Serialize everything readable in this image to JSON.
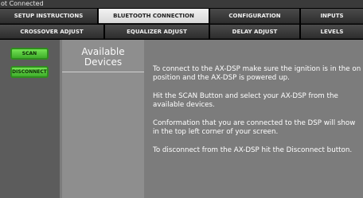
{
  "status": {
    "connection_text": "ot Connected"
  },
  "tabs": {
    "row1": [
      {
        "label": "SETUP INSTRUCTIONS",
        "active": false
      },
      {
        "label": "BLUETOOTH CONNECTION",
        "active": true
      },
      {
        "label": "CONFIGURATION",
        "active": false
      },
      {
        "label": "INPUTS",
        "active": false
      }
    ],
    "row2": [
      {
        "label": "CROSSOVER ADJUST",
        "active": false
      },
      {
        "label": "EQUALIZER ADJUST",
        "active": false
      },
      {
        "label": "DELAY ADJUST",
        "active": false
      },
      {
        "label": "LEVELS",
        "active": false
      }
    ]
  },
  "buttons": {
    "scan_label": "SCAN",
    "disconnect_label": "DISCONNECT"
  },
  "devices": {
    "title": "Available Devices"
  },
  "instructions": {
    "paragraphs": [
      "To connect to the AX-DSP make sure the ignition is in the on position and the AX-DSP is powered up.",
      "Hit the SCAN Button and select your AX-DSP from the available devices.",
      "Conformation that you are connected to the DSP will show in the top left corner of your screen.",
      "To disconnect from the AX-DSP hit the Disconnect button."
    ]
  },
  "colors": {
    "button_green": "#4fc236",
    "active_tab": "#e6e6e6",
    "inactive_tab": "#3a3a3a",
    "panel_gray": "#7c7c7c"
  }
}
